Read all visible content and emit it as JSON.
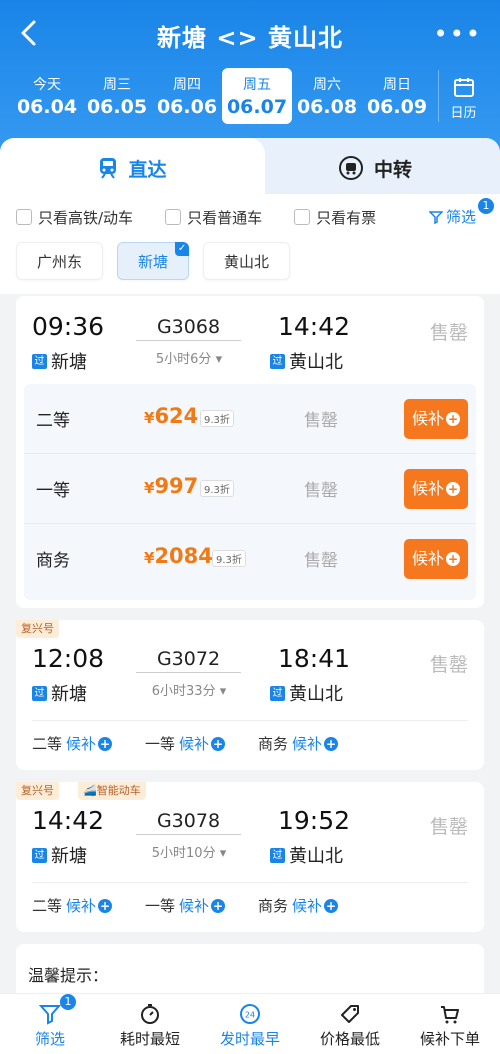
{
  "header": {
    "title": "新塘 <> 黄山北"
  },
  "dates": [
    {
      "w": "今天",
      "d": "06.04"
    },
    {
      "w": "周三",
      "d": "06.05"
    },
    {
      "w": "周四",
      "d": "06.06"
    },
    {
      "w": "周五",
      "d": "06.07"
    },
    {
      "w": "周六",
      "d": "06.08"
    },
    {
      "w": "周日",
      "d": "06.09"
    }
  ],
  "calendar_label": "日历",
  "tabs": {
    "direct": "直达",
    "transfer": "中转"
  },
  "filters": {
    "opt1": "只看高铁/动车",
    "opt2": "只看普通车",
    "opt3": "只看有票",
    "screen": "筛选",
    "screen_badge": "1"
  },
  "stations": [
    "广州东",
    "新塘",
    "黄山北"
  ],
  "trains": [
    {
      "dep": "09:36",
      "arr": "14:42",
      "no": "G3068",
      "dur": "5小时6分",
      "from": "新塘",
      "to": "黄山北",
      "status": "售罄",
      "via": "过",
      "seats": [
        {
          "name": "二等",
          "cur": "¥",
          "price": "624",
          "disc": "9.3折",
          "status": "售罄",
          "btn": "候补"
        },
        {
          "name": "一等",
          "cur": "¥",
          "price": "997",
          "disc": "9.3折",
          "status": "售罄",
          "btn": "候补"
        },
        {
          "name": "商务",
          "cur": "¥",
          "price": "2084",
          "disc": "9.3折",
          "status": "售罄",
          "btn": "候补"
        }
      ]
    },
    {
      "tag": "复兴号",
      "dep": "12:08",
      "arr": "18:41",
      "no": "G3072",
      "dur": "6小时33分",
      "from": "新塘",
      "to": "黄山北",
      "status": "售罄",
      "via": "过",
      "seats": [
        {
          "name": "二等",
          "act": "候补"
        },
        {
          "name": "一等",
          "act": "候补"
        },
        {
          "name": "商务",
          "act": "候补"
        }
      ]
    },
    {
      "tag": "复兴号",
      "tag2": "智能动车",
      "dep": "14:42",
      "arr": "19:52",
      "no": "G3078",
      "dur": "5小时10分",
      "from": "新塘",
      "to": "黄山北",
      "status": "售罄",
      "via": "过",
      "seats": [
        {
          "name": "二等",
          "act": "候补"
        },
        {
          "name": "一等",
          "act": "候补"
        },
        {
          "name": "商务",
          "act": "候补"
        }
      ]
    }
  ],
  "tips": "温馨提示：",
  "bottom": [
    {
      "label": "筛选",
      "badge": "1"
    },
    {
      "label": "耗时最短"
    },
    {
      "label": "发时最早"
    },
    {
      "label": "价格最低"
    },
    {
      "label": "候补下单"
    }
  ],
  "colors": {
    "primary": "#1a85e8",
    "orange": "#f5781e",
    "price": "#f07b16"
  }
}
